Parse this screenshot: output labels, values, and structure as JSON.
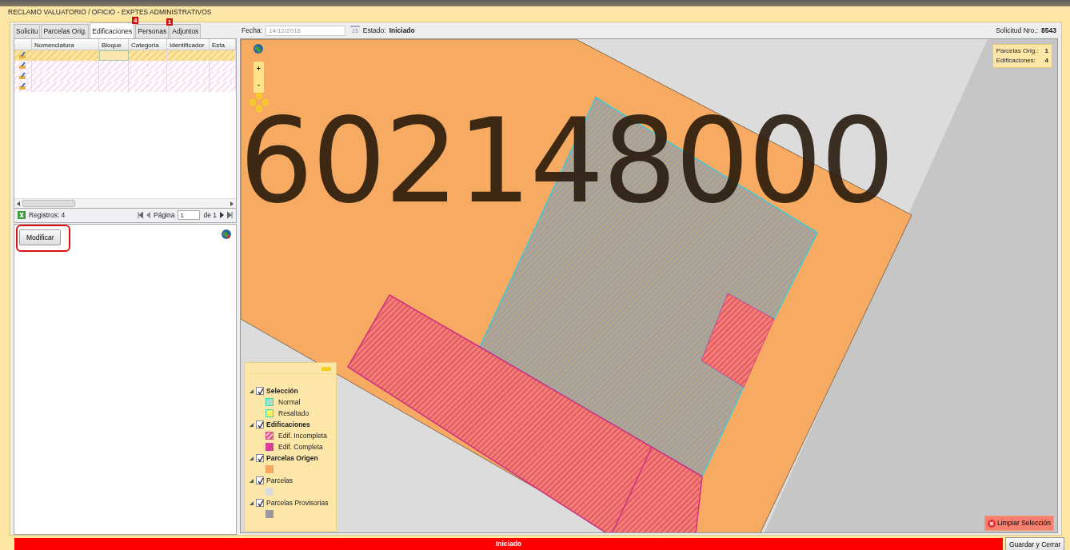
{
  "title_bar": {
    "title": "RECLAMO VALUATORIO / OFICIO  -  EXPTES ADMINISTRATIVOS"
  },
  "tabs": [
    {
      "label": "Solicitu",
      "selected": false
    },
    {
      "label": "Parcelas Orig.",
      "selected": false
    },
    {
      "label": "Edificaciones",
      "selected": true,
      "badge": "4"
    },
    {
      "label": "Personas",
      "selected": false,
      "badge": "1"
    },
    {
      "label": "Adjuntos",
      "selected": false
    }
  ],
  "header": {
    "fecha_label": "Fecha:",
    "fecha_value": "14/12/2016",
    "calendar_day": "15",
    "estado_label": "Estado:",
    "estado_value": "Iniciado",
    "solicitud_label": "Solicitud Nro.:",
    "solicitud_value": "8543"
  },
  "table": {
    "columns": [
      "Nomenclatura",
      "Bloque",
      "Categoria",
      "Identificador",
      "Esta"
    ],
    "rows": [
      {
        "selected": true,
        "categoria": "-"
      },
      {
        "selected": false,
        "categoria": "-"
      },
      {
        "selected": false,
        "categoria": "-"
      },
      {
        "selected": false,
        "categoria": "-"
      }
    ]
  },
  "pager": {
    "records": "Registros: 4",
    "page_label": "Página",
    "page_value": "1",
    "page_of": "de 1"
  },
  "modify_button": "Modificar",
  "map": {
    "parcel_label": "602148000",
    "zoom_in": "+",
    "zoom_out": "-",
    "counts": [
      {
        "label": "Parcelas Orig.:",
        "value": "1"
      },
      {
        "label": "Edificaciones:",
        "value": "4"
      }
    ],
    "clear_button": "Limpiar Selección"
  },
  "legend": [
    {
      "label": "Selección",
      "emphasized": true,
      "checked": true,
      "items": [
        {
          "label": "Normal",
          "color": "#a8e0c4",
          "kind": "outlined"
        },
        {
          "label": "Resaltado",
          "color": "#f5f060",
          "kind": "outlined"
        }
      ]
    },
    {
      "label": "Edificaciones",
      "emphasized": true,
      "checked": true,
      "items": [
        {
          "label": "Edif. Incompleta",
          "color": "#e0508a",
          "kind": "hatched"
        },
        {
          "label": "Edif. Completa",
          "color": "#d8409a",
          "kind": "solid"
        }
      ]
    },
    {
      "label": "Parcelas Origen",
      "emphasized": true,
      "checked": true,
      "items": [
        {
          "color": "#f7a860",
          "kind": "solid"
        }
      ]
    },
    {
      "label": "Parcelas",
      "emphasized": false,
      "checked": true,
      "items": [
        {
          "color": "#dcdcdc",
          "kind": "solid"
        }
      ]
    },
    {
      "label": "Parcelas Provisorias",
      "emphasized": false,
      "checked": true,
      "items": [
        {
          "color": "#999999",
          "kind": "solid"
        }
      ]
    }
  ],
  "status_bar": {
    "status": "Iniciado",
    "save_button": "Guardar y Cerrar"
  }
}
